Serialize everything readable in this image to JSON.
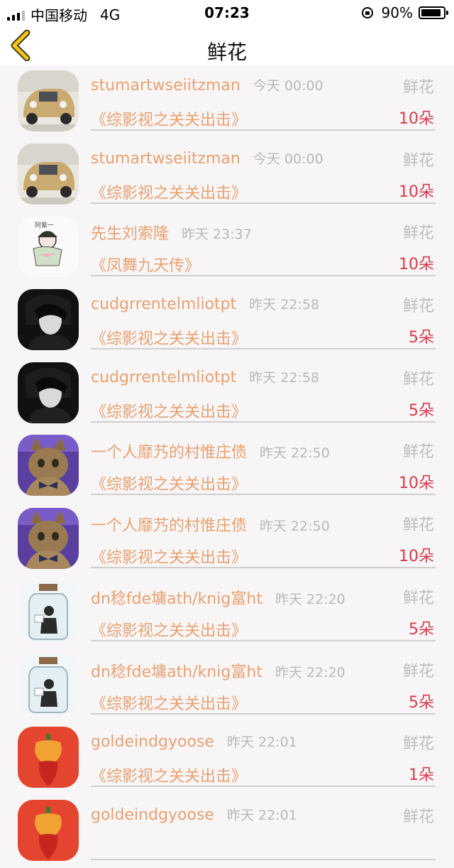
{
  "status_bar": {
    "carrier": "中国移动",
    "network": "4G",
    "time": "07:23",
    "battery_percent": "90%",
    "battery_level": 0.9
  },
  "nav": {
    "back_icon": "chevron-left-icon",
    "title": "鲜花"
  },
  "colors": {
    "accent_yellow": "#f5c518",
    "username": "#e8a271",
    "count": "#d73c4c",
    "muted": "#bdbdbd"
  },
  "items": [
    {
      "username": "stumartwseiitzman",
      "time": "今天 00:00",
      "type": "鲜花",
      "book": "《综影视之关关出击》",
      "count": "10朵",
      "avatar": "car"
    },
    {
      "username": "stumartwseiitzman",
      "time": "今天 00:00",
      "type": "鲜花",
      "book": "《综影视之关关出击》",
      "count": "10朵",
      "avatar": "car"
    },
    {
      "username": "先生刘索隆",
      "time": "昨天 23:37",
      "type": "鲜花",
      "book": "《凤舞九天传》",
      "count": "10朵",
      "avatar": "sketch"
    },
    {
      "username": "cudgrrentelmliotpt",
      "time": "昨天 22:58",
      "type": "鲜花",
      "book": "《综影视之关关出击》",
      "count": "5朵",
      "avatar": "dark"
    },
    {
      "username": "cudgrrentelmliotpt",
      "time": "昨天 22:58",
      "type": "鲜花",
      "book": "《综影视之关关出击》",
      "count": "5朵",
      "avatar": "dark"
    },
    {
      "username": "一个人靡艿的村惟庄债",
      "time": "昨天 22:50",
      "type": "鲜花",
      "book": "《综影视之关关出击》",
      "count": "10朵",
      "avatar": "cat"
    },
    {
      "username": "一个人靡艿的村惟庄债",
      "time": "昨天 22:50",
      "type": "鲜花",
      "book": "《综影视之关关出击》",
      "count": "10朵",
      "avatar": "cat"
    },
    {
      "username": "dn稔fde墉ath/knig富ht",
      "time": "昨天 22:20",
      "type": "鲜花",
      "book": "《综影视之关关出击》",
      "count": "5朵",
      "avatar": "jar"
    },
    {
      "username": "dn稔fde墉ath/knig富ht",
      "time": "昨天 22:20",
      "type": "鲜花",
      "book": "《综影视之关关出击》",
      "count": "5朵",
      "avatar": "jar"
    },
    {
      "username": "goldeindgyoose",
      "time": "昨天 22:01",
      "type": "鲜花",
      "book": "《综影视之关关出击》",
      "count": "1朵",
      "avatar": "pepper"
    },
    {
      "username": "goldeindgyoose",
      "time": "昨天 22:01",
      "type": "鲜花",
      "book": "",
      "count": "",
      "avatar": "pepper"
    }
  ]
}
